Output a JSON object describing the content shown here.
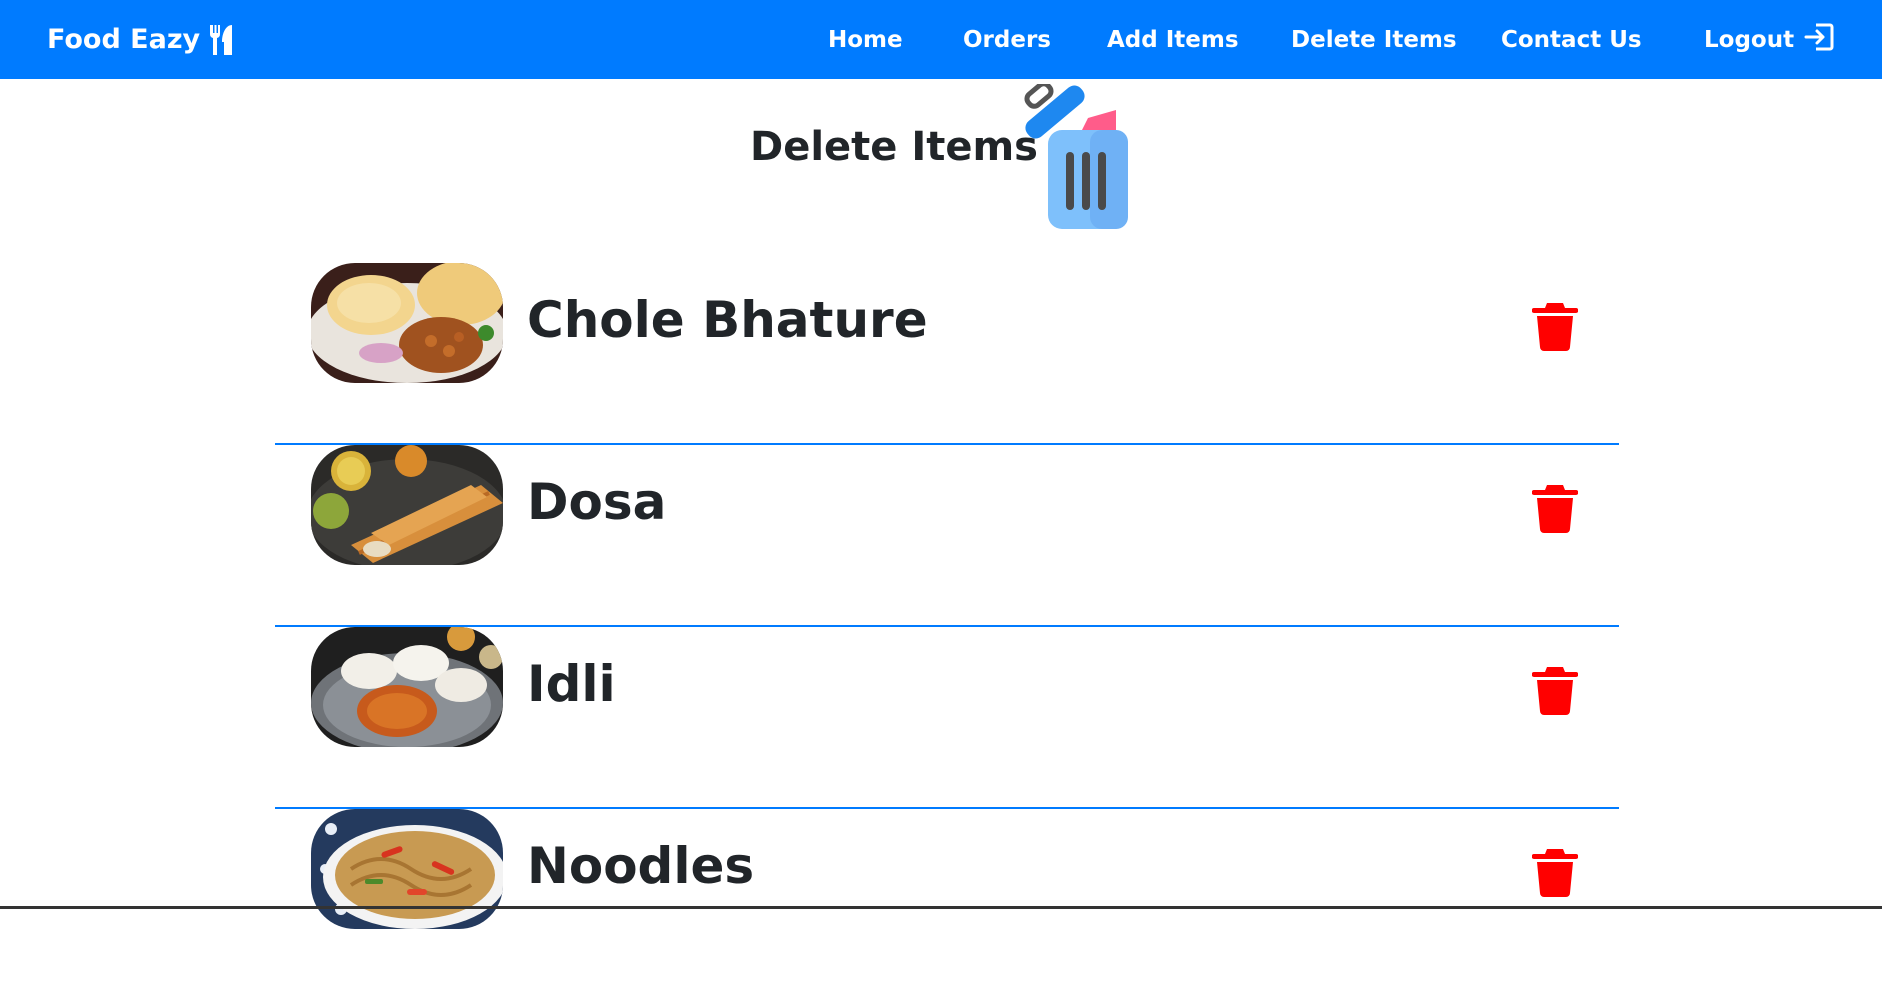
{
  "navbar": {
    "brand": "Food Eazy",
    "links": {
      "home": "Home",
      "orders": "Orders",
      "add_items": "Add Items",
      "delete_items": "Delete Items",
      "contact_us": "Contact Us",
      "logout": "Logout"
    },
    "background_color": "#007bff"
  },
  "page": {
    "title": "Delete Items"
  },
  "items": [
    {
      "name": "Chole Bhature",
      "image": "chole-bhature-photo"
    },
    {
      "name": "Dosa",
      "image": "dosa-photo"
    },
    {
      "name": "Idli",
      "image": "idli-photo"
    },
    {
      "name": "Noodles",
      "image": "noodles-photo"
    }
  ],
  "colors": {
    "accent": "#007bff",
    "delete_icon": "#ff0000",
    "text": "#212529"
  },
  "icons": {
    "brand": "fork-knife-icon",
    "logout": "logout-icon",
    "delete": "trash-icon",
    "header": "trash-bin-illustration"
  }
}
